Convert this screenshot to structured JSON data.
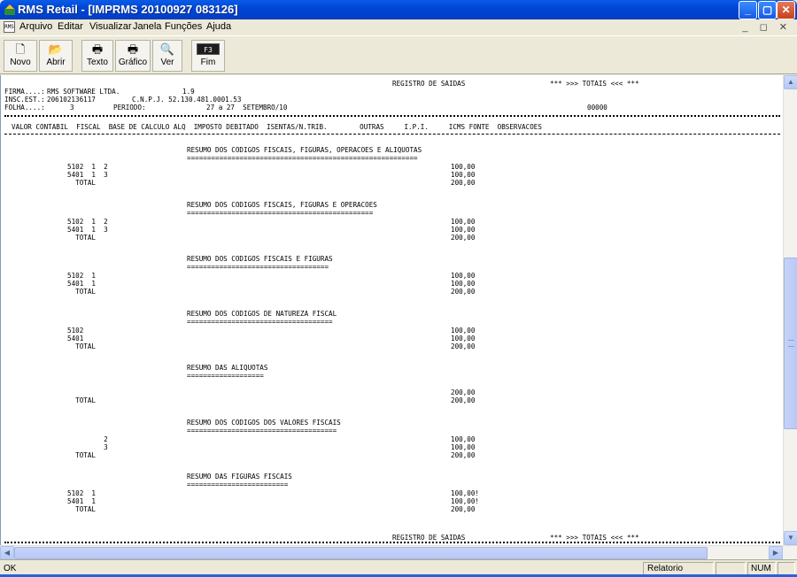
{
  "window": {
    "title": "RMS Retail - [IMPRMS 20100927 083126]"
  },
  "menu": {
    "icon_text": "RMS",
    "items": [
      "Arquivo",
      "Editar",
      "Visualizar",
      "Janela",
      "Funções",
      "Ajuda"
    ],
    "mdi_controls": "_ ◻ ✕"
  },
  "toolbar": {
    "buttons": [
      {
        "label": "Novo",
        "icon": "new-file-icon"
      },
      {
        "label": "Abrir",
        "icon": "open-folder-icon"
      },
      {
        "label": "Texto",
        "icon": "printer-icon"
      },
      {
        "label": "Gráfico",
        "icon": "printer-graphic-icon"
      },
      {
        "label": "Ver",
        "icon": "preview-icon"
      },
      {
        "label": "Fim",
        "icon": "f3-key-icon",
        "key": "F3"
      }
    ]
  },
  "report": {
    "header_title": "REGISTRO DE SAIDAS",
    "header_totals": "*** >>> TOTAIS <<< ***",
    "firma_label": "FIRMA....:",
    "firma_value": "RMS SOFTWARE LTDA.",
    "version": "1.9",
    "insc_label": "INSC.EST.:",
    "insc_value": "206102136117",
    "cnpj": "C.N.P.J. 52.130.481.0001.53",
    "folha_label": "FOLHA....:",
    "folha_value": "3",
    "periodo_label": "PERIODO:",
    "periodo_value": "27 a 27  SETEMBRO/10",
    "code": "00000",
    "columns": "VALOR CONTABIL  FISCAL  BASE DE CALCULO ALQ  IMPOSTO DEBITADO  ISENTAS/N.TRIB.        OUTRAS     I.P.I.     ICMS FONTE  OBSERVACOES",
    "sections": [
      {
        "title": "RESUMO DOS CODIGOS FISCAIS, FIGURAS, OPERACOES E ALIQUOTAS",
        "underline": "=========================================================",
        "rows": [
          {
            "label": "5102  1  2",
            "value": "100,00"
          },
          {
            "label": "5401  1  3",
            "value": "100,00"
          },
          {
            "label": "  TOTAL",
            "value": "200,00"
          }
        ]
      },
      {
        "title": "RESUMO DOS CODIGOS FISCAIS, FIGURAS E OPERACOES",
        "underline": "==============================================",
        "rows": [
          {
            "label": "5102  1  2",
            "value": "100,00"
          },
          {
            "label": "5401  1  3",
            "value": "100,00"
          },
          {
            "label": "  TOTAL",
            "value": "200,00"
          }
        ]
      },
      {
        "title": "RESUMO DOS CODIGOS FISCAIS E FIGURAS",
        "underline": "===================================",
        "rows": [
          {
            "label": "5102  1",
            "value": "100,00"
          },
          {
            "label": "5401  1",
            "value": "100,00"
          },
          {
            "label": "  TOTAL",
            "value": "200,00"
          }
        ]
      },
      {
        "title": "RESUMO DOS CODIGOS DE NATUREZA FISCAL",
        "underline": "====================================",
        "rows": [
          {
            "label": "5102",
            "value": "100,00"
          },
          {
            "label": "5401",
            "value": "100,00"
          },
          {
            "label": "  TOTAL",
            "value": "200,00"
          }
        ]
      },
      {
        "title": "RESUMO DAS ALIQUOTAS",
        "underline": "===================",
        "rows": [
          {
            "label": "",
            "value": "200,00"
          },
          {
            "label": "  TOTAL",
            "value": "200,00"
          }
        ]
      },
      {
        "title": "RESUMO DOS CODIGOS DOS VALORES FISCAIS",
        "underline": "=====================================",
        "rows": [
          {
            "label": "         2",
            "value": "100,00"
          },
          {
            "label": "         3",
            "value": "100,00"
          },
          {
            "label": "  TOTAL",
            "value": "200,00"
          }
        ]
      },
      {
        "title": "RESUMO DAS FIGURAS FISCAIS",
        "underline": "=========================",
        "rows": [
          {
            "label": "5102  1",
            "value": "100,00!"
          },
          {
            "label": "5401  1",
            "value": "100,00!"
          },
          {
            "label": "  TOTAL",
            "value": "200,00"
          }
        ]
      }
    ],
    "footer_title": "REGISTRO DE SAIDAS",
    "footer_totals": "*** >>> TOTAIS <<< ***"
  },
  "statusbar": {
    "left": "OK",
    "panel": "Relatorio",
    "num": "NUM"
  },
  "colors": {
    "titlebar": "#0046d5",
    "chrome": "#ece9d8",
    "scrollbar": "#c6d3f7"
  }
}
